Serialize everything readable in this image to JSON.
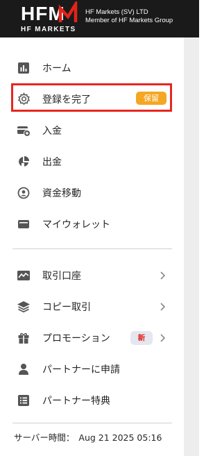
{
  "header": {
    "brand_wordmark": "HFM",
    "brand_tagline": "HF MARKETS",
    "company_line1": "HF Markets (SV) LTD",
    "company_line2": "Member of HF Markets Group"
  },
  "menu": {
    "items": [
      {
        "label": "ホーム",
        "icon": "bar-chart-icon"
      },
      {
        "label": "登録を完了",
        "icon": "gear-icon",
        "badge": "保留"
      },
      {
        "label": "入金",
        "icon": "deposit-card-icon"
      },
      {
        "label": "出金",
        "icon": "withdraw-pie-icon"
      },
      {
        "label": "資金移動",
        "icon": "transfer-user-icon"
      },
      {
        "label": "マイウォレット",
        "icon": "wallet-icon"
      },
      {
        "label": "取引口座",
        "icon": "trading-chart-icon"
      },
      {
        "label": "コピー取引",
        "icon": "layers-icon"
      },
      {
        "label": "プロモーション",
        "icon": "gift-icon",
        "badge": "新"
      },
      {
        "label": "パートナーに申請",
        "icon": "person-icon"
      },
      {
        "label": "パートナー特典",
        "icon": "list-icon"
      }
    ]
  },
  "footer": {
    "server_time_label": "サーバー時間：",
    "server_time_value": "Aug 21 2025 05:16"
  },
  "colors": {
    "header_bg": "#1a1a1a",
    "brand_red": "#e2231a",
    "pending_badge": "#f5a623",
    "highlight_border": "#e8261f"
  }
}
